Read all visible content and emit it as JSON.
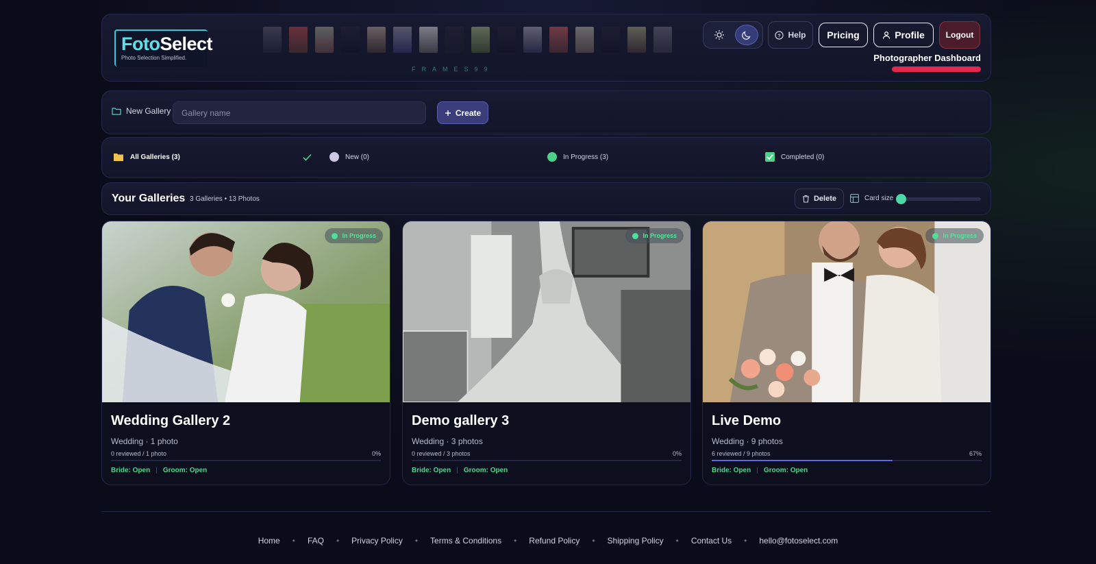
{
  "header": {
    "logo_main": "Foto",
    "logo_accent": "Select",
    "logo_tagline": "Photo Selection Simplified.",
    "frames_label": "FRAMES99",
    "help_label": "Help",
    "pricing_label": "Pricing",
    "profile_label": "Profile",
    "logout_label": "Logout",
    "dashboard_title": "Photographer Dashboard",
    "theme_light_icon": "sun-icon",
    "theme_dark_icon": "moon-icon"
  },
  "new_gallery": {
    "label": "New Gallery",
    "placeholder": "Gallery name",
    "create_label": "Create"
  },
  "filters": [
    {
      "label": "All Galleries (3)",
      "icon": "folder-icon",
      "color": "#f2c14e"
    },
    {
      "label": "New (0)",
      "icon": "circle-icon",
      "color": "#cfc9e6"
    },
    {
      "label": "In Progress (3)",
      "icon": "circle-icon",
      "color": "#4fd18b"
    },
    {
      "label": "Completed (0)",
      "icon": "checkbox-icon",
      "color": "#4fd18b"
    }
  ],
  "galleries_bar": {
    "title": "Your Galleries",
    "count": "3 Galleries • 13 Photos",
    "delete_label": "Delete",
    "card_size_label": "Card size"
  },
  "cards": [
    {
      "title": "Wedding Gallery 2",
      "badge": "In Progress",
      "subtitle": "Wedding · 1 photo",
      "reviewed": "0 reviewed / 1 photo",
      "percent": "0%",
      "progress": 0,
      "bride": "Bride: Open",
      "groom": "Groom: Open"
    },
    {
      "title": "Demo gallery 3",
      "badge": "In Progress",
      "subtitle": "Wedding · 3 photos",
      "reviewed": "0 reviewed / 3 photos",
      "percent": "0%",
      "progress": 0,
      "bride": "Bride: Open",
      "groom": "Groom: Open"
    },
    {
      "title": "Live Demo",
      "badge": "In Progress",
      "subtitle": "Wedding · 9 photos",
      "reviewed": "6 reviewed / 9 photos",
      "percent": "67%",
      "progress": 67,
      "bride": "Bride: Open",
      "groom": "Groom: Open"
    }
  ],
  "footer": {
    "links": [
      "Home",
      "FAQ",
      "Privacy Policy",
      "Terms & Conditions",
      "Refund Policy",
      "Shipping Policy",
      "Contact Us",
      "hello@fotoselect.com"
    ]
  },
  "colors": {
    "accent": "#4dd9a6",
    "status_green": "#4ed68c",
    "logout_red": "#4a1c2c",
    "dashboard_bar": "#e3284f"
  }
}
